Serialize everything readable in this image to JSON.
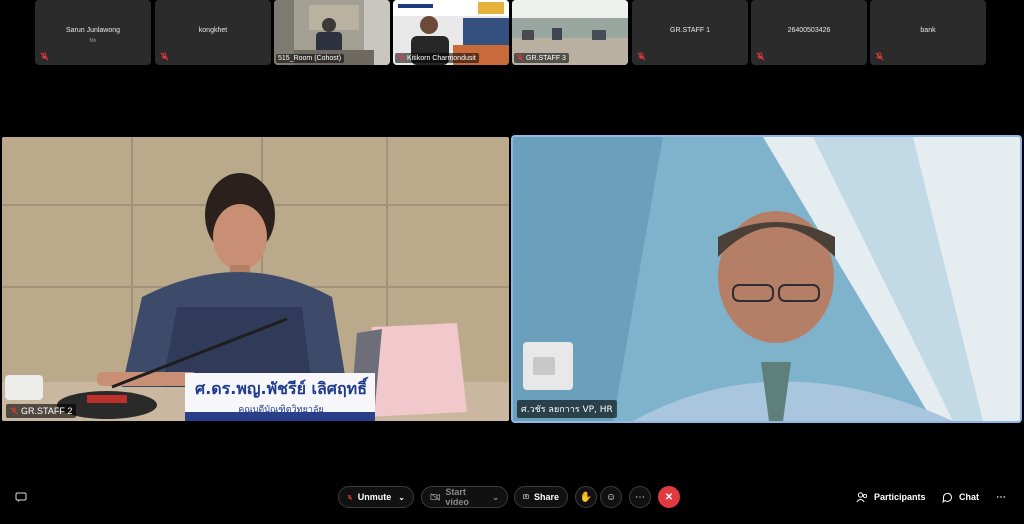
{
  "thumbnails": [
    {
      "name": "Sarun Junlawong",
      "sub": "Me",
      "muted": true
    },
    {
      "name": "kongkhet",
      "muted": true
    },
    {
      "label": "515_Room (Cohost)",
      "video": true
    },
    {
      "label": "Kitikorn Charmondusit",
      "video": true,
      "muted": true
    },
    {
      "label": "GR.STAFF 3",
      "video": true,
      "muted": true
    },
    {
      "name": "GR.STAFF 1",
      "muted": true
    },
    {
      "name": "26400503426",
      "muted": true
    },
    {
      "name": "bank",
      "muted": true
    }
  ],
  "main": {
    "left_label": "GR.STAFF 2",
    "right_label": "ศ.วชัร ลยกาาร VP, HR",
    "nameplate": {
      "line1": "ศ.ดร.พญ.พัชรีย์ เลิศฤทธิ์",
      "line2": "คณบดีบัณฑิตวิทยาลัย"
    }
  },
  "toolbar": {
    "unmute": "Unmute",
    "start_video": "Start video",
    "share": "Share",
    "participants": "Participants",
    "chat": "Chat"
  },
  "colors": {
    "end_call": "#e0393e",
    "active_border": "#8fb8e8",
    "mute_red": "#e0393e"
  }
}
